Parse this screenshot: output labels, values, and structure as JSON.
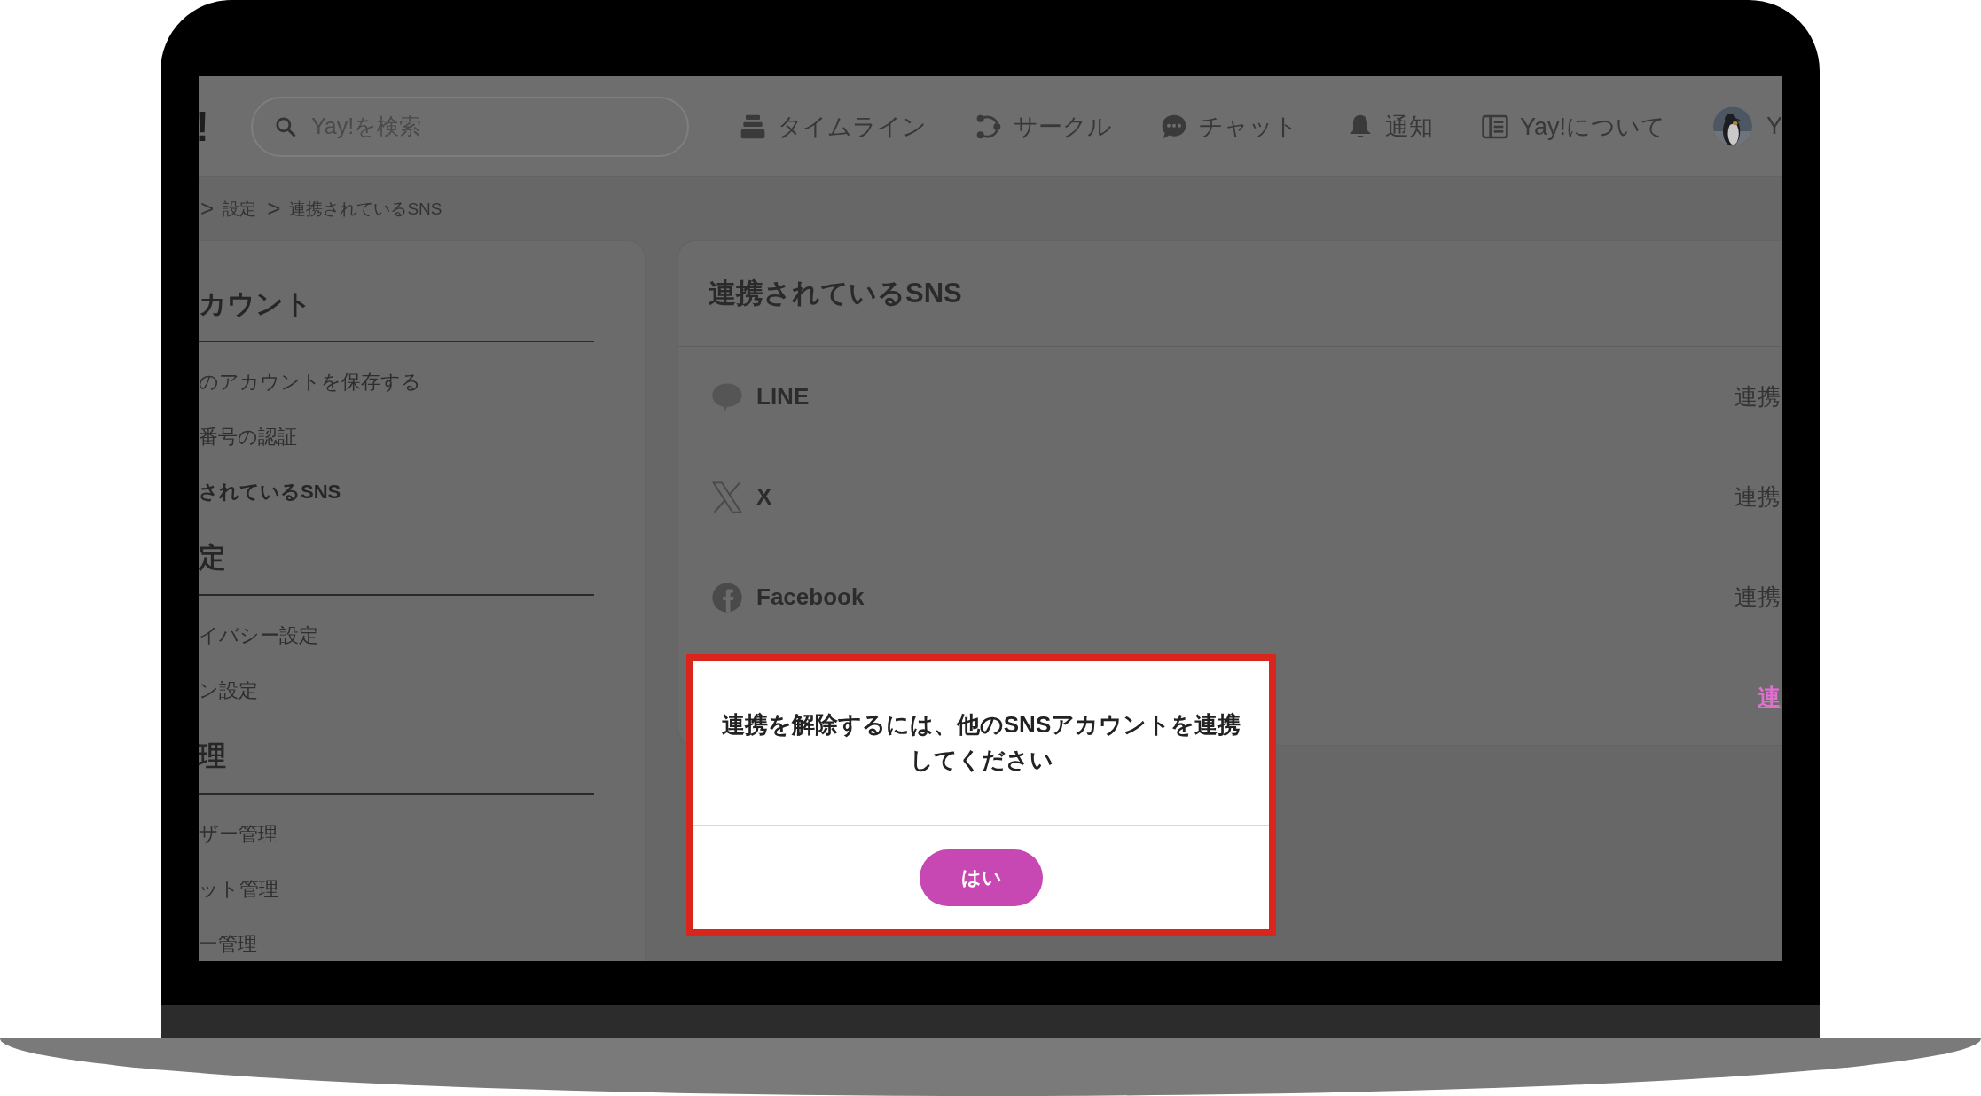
{
  "header": {
    "logo": "!",
    "search": {
      "placeholder": "Yay!を検索"
    },
    "nav": [
      {
        "kind": "timeline",
        "label": "タイムライン"
      },
      {
        "kind": "circle",
        "label": "サークル"
      },
      {
        "kind": "chat",
        "label": "チャット"
      },
      {
        "kind": "bell",
        "label": "通知"
      },
      {
        "kind": "about",
        "label": "Yay!について"
      }
    ],
    "user": {
      "name": "Y"
    }
  },
  "breadcrumb": [
    {
      "sep": ">",
      "label": "設定"
    },
    {
      "sep": ">",
      "label": "連携されているSNS"
    }
  ],
  "sidebar": [
    {
      "heading": "カウント",
      "items": [
        {
          "label": "のアカウントを保存する",
          "selected": false
        },
        {
          "label": "番号の認証",
          "selected": false
        },
        {
          "label": "されているSNS",
          "selected": true
        }
      ]
    },
    {
      "heading": "定",
      "items": [
        {
          "label": "イバシー設定",
          "selected": false
        },
        {
          "label": "ン設定",
          "selected": false
        }
      ]
    },
    {
      "heading": "理",
      "items": [
        {
          "label": "ザー管理",
          "selected": false
        },
        {
          "label": "ット管理",
          "selected": false
        },
        {
          "label": "ー管理",
          "selected": false
        }
      ]
    }
  ],
  "main": {
    "title": "連携されているSNS",
    "rows": [
      {
        "kind": "line",
        "name": "LINE",
        "action": "連携",
        "highlighted": false
      },
      {
        "kind": "x",
        "name": "X",
        "action": "連携",
        "highlighted": false
      },
      {
        "kind": "facebook",
        "name": "Facebook",
        "action": "連携",
        "highlighted": false
      },
      {
        "kind": "hidden",
        "action": "連",
        "highlighted": true
      }
    ]
  },
  "dialog": {
    "message": "連携を解除するには、他のSNSアカウントを連携してください",
    "button": "はい"
  }
}
